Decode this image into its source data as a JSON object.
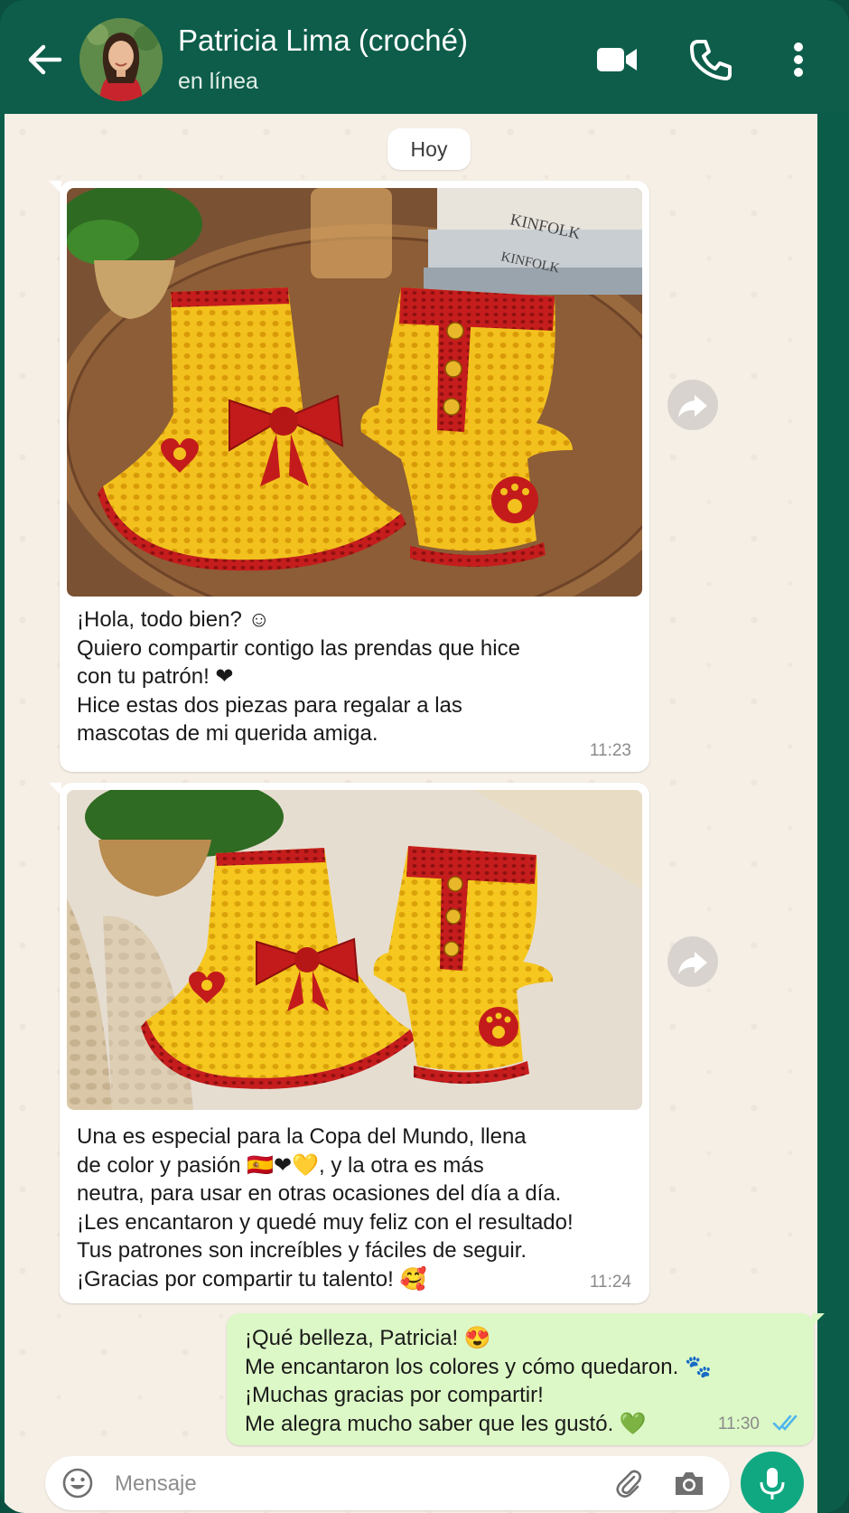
{
  "header": {
    "contact_name": "Patricia Lima (croché)",
    "status": "en línea",
    "icons": [
      "back-arrow-icon",
      "video-call-icon",
      "phone-icon",
      "more-vert-icon"
    ]
  },
  "chat": {
    "date_chip": "Hoy",
    "messages": [
      {
        "direction": "incoming",
        "has_image": true,
        "text": "¡Hola, todo bien? ☺\nQuiero compartir contigo las prendas que hice\ncon tu patrón! ❤\nHice estas dos piezas para regalar a las\nmascotas de mi querida amiga.",
        "time": "11:23"
      },
      {
        "direction": "incoming",
        "has_image": true,
        "text": "Una es especial para la Copa del Mundo, llena\nde color y pasión 🇪🇸❤💛, y la otra es más\nneutra, para usar en otras ocasiones del día a día.\n¡Les encantaron y quedé muy feliz con el resultado!\nTus patrones son increíbles y fáciles de seguir.\n¡Gracias por compartir tu talento! 🥰",
        "time": "11:24"
      },
      {
        "direction": "outgoing",
        "has_image": false,
        "text": "¡Qué belleza, Patricia! 😍\nMe encantaron los colores y cómo quedaron. 🐾\n¡Muchas gracias por compartir!\nMe alegra mucho saber que les gustó. 💚",
        "time": "11:30",
        "status": "read"
      }
    ]
  },
  "input": {
    "placeholder": "Mensaje",
    "icons": [
      "emoji-icon",
      "attach-icon",
      "camera-icon",
      "mic-icon"
    ]
  },
  "colors": {
    "header_bg": "#0d5d4a",
    "chat_bg": "#f6efe6",
    "outgoing_bubble": "#dcf8c6",
    "accent_green": "#10a881",
    "read_ticks": "#4fb6ec"
  }
}
